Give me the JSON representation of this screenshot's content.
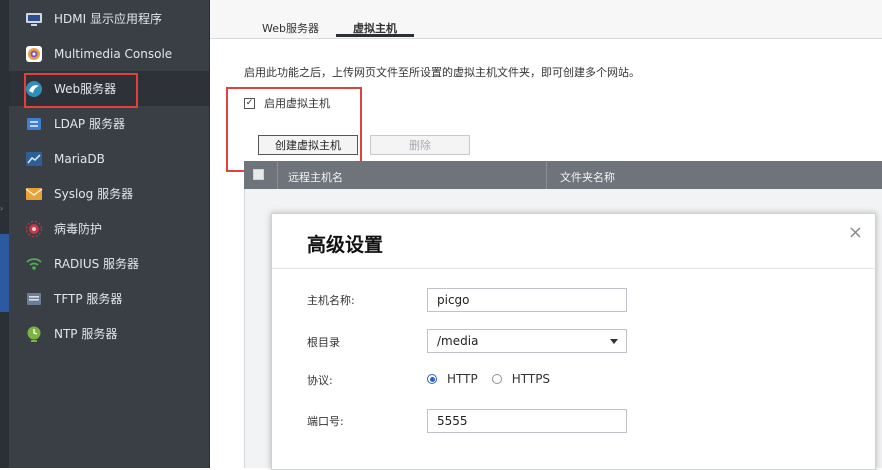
{
  "sidebar": {
    "items": [
      {
        "label": "HDMI 显示应用程序",
        "icon": "monitor-icon"
      },
      {
        "label": "Multimedia Console",
        "icon": "multimedia-icon"
      },
      {
        "label": "Web服务器",
        "icon": "globe-icon"
      },
      {
        "label": "LDAP 服务器",
        "icon": "ldap-icon"
      },
      {
        "label": "MariaDB",
        "icon": "database-icon"
      },
      {
        "label": "Syslog 服务器",
        "icon": "envelope-icon"
      },
      {
        "label": "病毒防护",
        "icon": "virus-icon"
      },
      {
        "label": "RADIUS 服务器",
        "icon": "wifi-icon"
      },
      {
        "label": "TFTP 服务器",
        "icon": "tftp-icon"
      },
      {
        "label": "NTP 服务器",
        "icon": "clock-icon"
      }
    ],
    "selected_index": 2
  },
  "tabs": [
    {
      "label": "Web服务器"
    },
    {
      "label": "虚拟主机"
    }
  ],
  "active_tab": 1,
  "main": {
    "description": "启用此功能之后，上传网页文件至所设置的虚拟主机文件夹，即可创建多个网站。",
    "enable_label": "启用虚拟主机",
    "enable_checked": true,
    "create_button": "创建虚拟主机",
    "delete_button": "删除",
    "table_headers": [
      "远程主机名",
      "文件夹名称"
    ]
  },
  "dialog": {
    "title": "高级设置",
    "hostname_label": "主机名称:",
    "hostname_value": "picgo",
    "root_label": "根目录",
    "root_value": "/media",
    "protocol_label": "协议:",
    "protocol_options": [
      "HTTP",
      "HTTPS"
    ],
    "protocol_selected": "HTTP",
    "port_label": "端口号:",
    "port_value": "5555",
    "close_glyph": "×"
  },
  "colors": {
    "sidebar_bg": "#3a3f46",
    "highlight_red": "#e0413a",
    "radio_blue": "#2b63c7"
  }
}
